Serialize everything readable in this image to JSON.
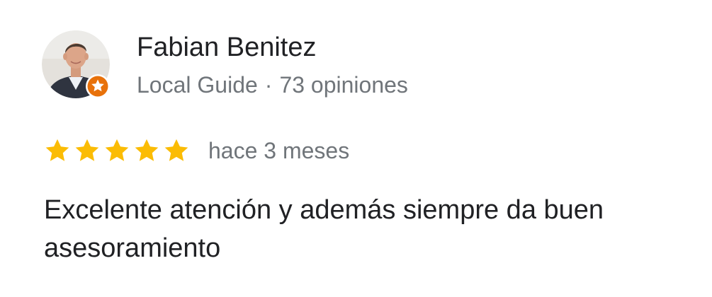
{
  "review": {
    "author": {
      "name": "Fabian Benitez",
      "badge": "Local Guide",
      "separator": "·",
      "reviews_count": "73 opiniones",
      "avatar_icon": "person-photo",
      "badge_icon": "local-guide-star-badge"
    },
    "rating": {
      "stars": 5,
      "max_stars": 5,
      "time": "hace 3 meses"
    },
    "text": "Excelente atención y además siempre da buen asesoramiento"
  },
  "colors": {
    "star": "#fbbc04",
    "badge": "#e8710a",
    "primary_text": "#202124",
    "secondary_text": "#70757a"
  }
}
